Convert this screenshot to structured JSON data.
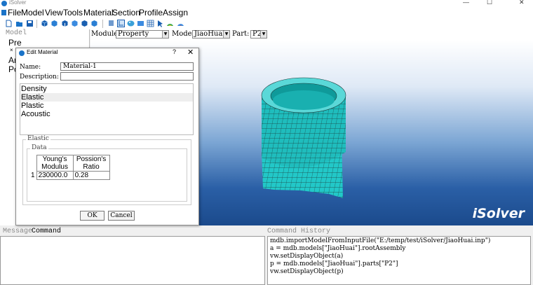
{
  "window": {
    "title": "iSolver",
    "minimize": "—",
    "maximize": "☐",
    "close": "✕"
  },
  "menu": [
    "File",
    "Model",
    "View",
    "Tools",
    "Material",
    "Section",
    "Profile",
    "Assign"
  ],
  "model_tree": {
    "header": "Model",
    "items": [
      "Pre",
      "×",
      "Ar",
      "Po"
    ]
  },
  "selectors": {
    "module_label": "Module:",
    "module_value": "Property",
    "model_label": "Model:",
    "model_value": "JiaoHuai",
    "part_label": "Part:",
    "part_value": "P2"
  },
  "viewport": {
    "logo": "iSolver"
  },
  "edit_material": {
    "title": "Edit Material",
    "help": "?",
    "close": "✕",
    "name_label": "Name:",
    "name_value": "Material-1",
    "description_label": "Description:",
    "description_value": "",
    "behaviors": [
      "Density",
      "Elastic",
      "Plastic",
      "Acoustic"
    ],
    "elastic_group": "Elastic",
    "data_group": "Data",
    "table": {
      "col1": "Young's Modulus",
      "col1a": "Young's",
      "col1b": "Modulus",
      "col2a": "Possion's",
      "col2b": "Ratio",
      "row_index": "1",
      "young": "230000.0",
      "poisson": "0.28"
    },
    "ok": "OK",
    "cancel": "Cancel"
  },
  "bottom": {
    "message_tab": "Message",
    "command_tab": "Command",
    "history_header": "Command History",
    "history": [
      "mdb.importModelFromInputFile(\"E:/temp/test/iSolver/JiaoHuai.inp\")",
      "a = mdb.models[\"JiaoHuai\"].rootAssembly",
      "vw.setDisplayObject(a)",
      "p = mdb.models[\"JiaoHuai\"].parts[\"P2\"]",
      "vw.setDisplayObject(p)"
    ]
  },
  "colors": {
    "accent": "#1a73c8",
    "mesh": "#1fc7c7",
    "mesh_lines": "#1a3a3a",
    "viewport_bottom": "#1b4a8c"
  }
}
